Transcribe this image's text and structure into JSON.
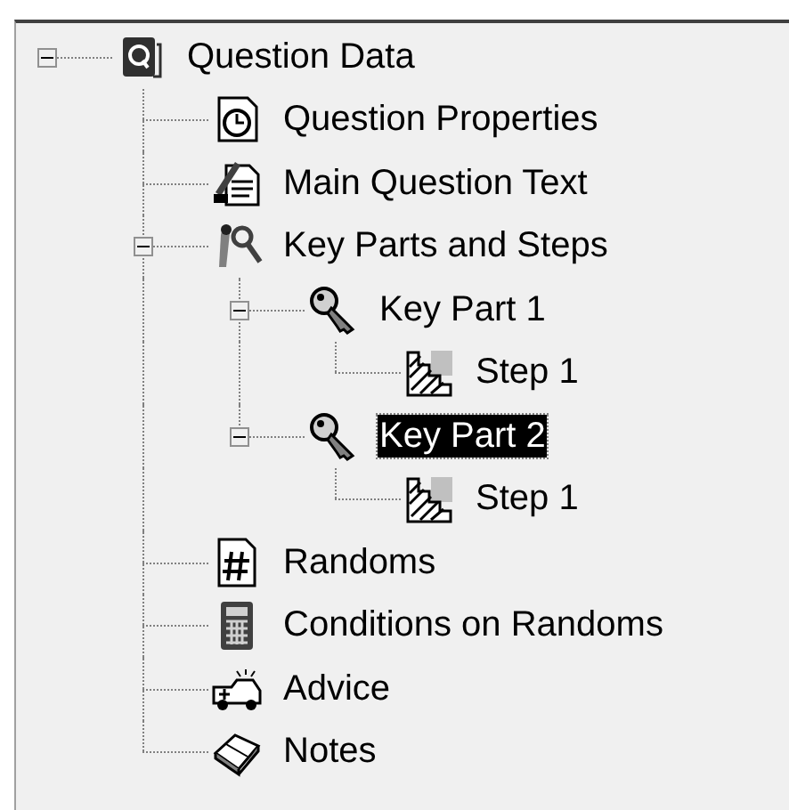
{
  "tree": [
    {
      "label": "Question Data",
      "kind": "root",
      "expanded": true,
      "selected": false,
      "children": [
        {
          "label": "Question Properties",
          "kind": "properties",
          "selected": false
        },
        {
          "label": "Main Question Text",
          "kind": "text",
          "selected": false
        },
        {
          "label": "Key Parts and Steps",
          "kind": "tools",
          "expanded": true,
          "selected": false,
          "children": [
            {
              "label": "Key Part 1",
              "kind": "key",
              "expanded": true,
              "selected": false,
              "children": [
                {
                  "label": "Step 1",
                  "kind": "step",
                  "selected": false
                }
              ]
            },
            {
              "label": "Key Part 2",
              "kind": "key",
              "expanded": true,
              "selected": true,
              "children": [
                {
                  "label": "Step 1",
                  "kind": "step",
                  "selected": false
                }
              ]
            }
          ]
        },
        {
          "label": "Randoms",
          "kind": "randoms",
          "selected": false
        },
        {
          "label": "Conditions on Randoms",
          "kind": "conditions",
          "selected": false
        },
        {
          "label": "Advice",
          "kind": "advice",
          "selected": false
        },
        {
          "label": "Notes",
          "kind": "notes",
          "selected": false
        }
      ]
    }
  ]
}
